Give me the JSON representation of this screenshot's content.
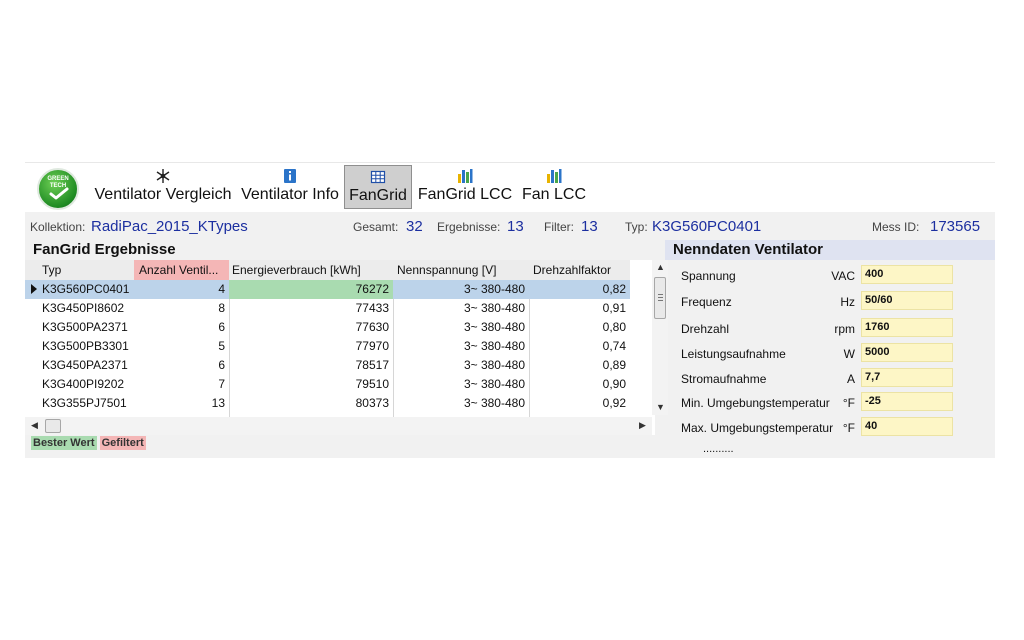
{
  "toolbar": {
    "logo_text_1": "GREEN",
    "logo_text_2": "TECH",
    "items": [
      {
        "label": "Ventilator Vergleich",
        "icon": "fan-icon"
      },
      {
        "label": "Ventilator Info",
        "icon": "info-icon"
      },
      {
        "label": "FanGrid",
        "icon": "grid-icon",
        "active": true
      },
      {
        "label": "FanGrid LCC",
        "icon": "bar-chart-icon"
      },
      {
        "label": "Fan LCC",
        "icon": "bar-chart-icon"
      }
    ]
  },
  "meta": {
    "kollektion_label": "Kollektion:",
    "kollektion_value": "RadiPac_2015_KTypes",
    "gesamt_label": "Gesamt:",
    "gesamt_value": "32",
    "ergebnisse_label": "Ergebnisse:",
    "ergebnisse_value": "13",
    "filter_label": "Filter:",
    "filter_value": "13",
    "typ_label": "Typ:",
    "typ_value": "K3G560PC0401",
    "messid_label": "Mess ID:",
    "messid_value": "173565"
  },
  "results": {
    "title": "FanGrid Ergebnisse",
    "columns": [
      "Typ",
      "Anzahl Ventil...",
      "Energieverbrauch [kWh]",
      "Nennspannung [V]",
      "Drehzahlfaktor"
    ],
    "rows": [
      {
        "typ": "K3G560PC0401",
        "anzahl": "4",
        "energie": "76272",
        "spannung": "3~ 380-480",
        "faktor": "0,82"
      },
      {
        "typ": "K3G450PI8602",
        "anzahl": "8",
        "energie": "77433",
        "spannung": "3~ 380-480",
        "faktor": "0,91"
      },
      {
        "typ": "K3G500PA2371",
        "anzahl": "6",
        "energie": "77630",
        "spannung": "3~ 380-480",
        "faktor": "0,80"
      },
      {
        "typ": "K3G500PB3301",
        "anzahl": "5",
        "energie": "77970",
        "spannung": "3~ 380-480",
        "faktor": "0,74"
      },
      {
        "typ": "K3G450PA2371",
        "anzahl": "6",
        "energie": "78517",
        "spannung": "3~ 380-480",
        "faktor": "0,89"
      },
      {
        "typ": "K3G400PI9202",
        "anzahl": "7",
        "energie": "79510",
        "spannung": "3~ 380-480",
        "faktor": "0,90"
      },
      {
        "typ": "K3G355PJ7501",
        "anzahl": "13",
        "energie": "80373",
        "spannung": "3~ 380-480",
        "faktor": "0,92"
      }
    ],
    "selected_row": 0
  },
  "legend": {
    "best": "Bester Wert",
    "filtered": "Gefiltert"
  },
  "nenndaten": {
    "title": "Nenndaten Ventilator",
    "rows": [
      {
        "label": "Spannung",
        "unit": "VAC",
        "value": "400"
      },
      {
        "label": "Frequenz",
        "unit": "Hz",
        "value": "50/60"
      },
      {
        "label": "Drehzahl",
        "unit": "rpm",
        "value": "1760"
      },
      {
        "label": "Leistungsaufnahme",
        "unit": "W",
        "value": "5000"
      },
      {
        "label": "Stromaufnahme",
        "unit": "A",
        "value": "7,7"
      },
      {
        "label": "Min. Umgebungstemperatur",
        "unit": "°F",
        "value": "-25"
      },
      {
        "label": "Max. Umgebungstemperatur",
        "unit": "°F",
        "value": "40"
      }
    ],
    "more": ".........."
  },
  "colors": {
    "best": "#a9dbb0",
    "filtered": "#f4b6b6",
    "selected": "#bcd3ea",
    "value_field": "#fdf6c6",
    "link_value": "#1c2fa0"
  }
}
